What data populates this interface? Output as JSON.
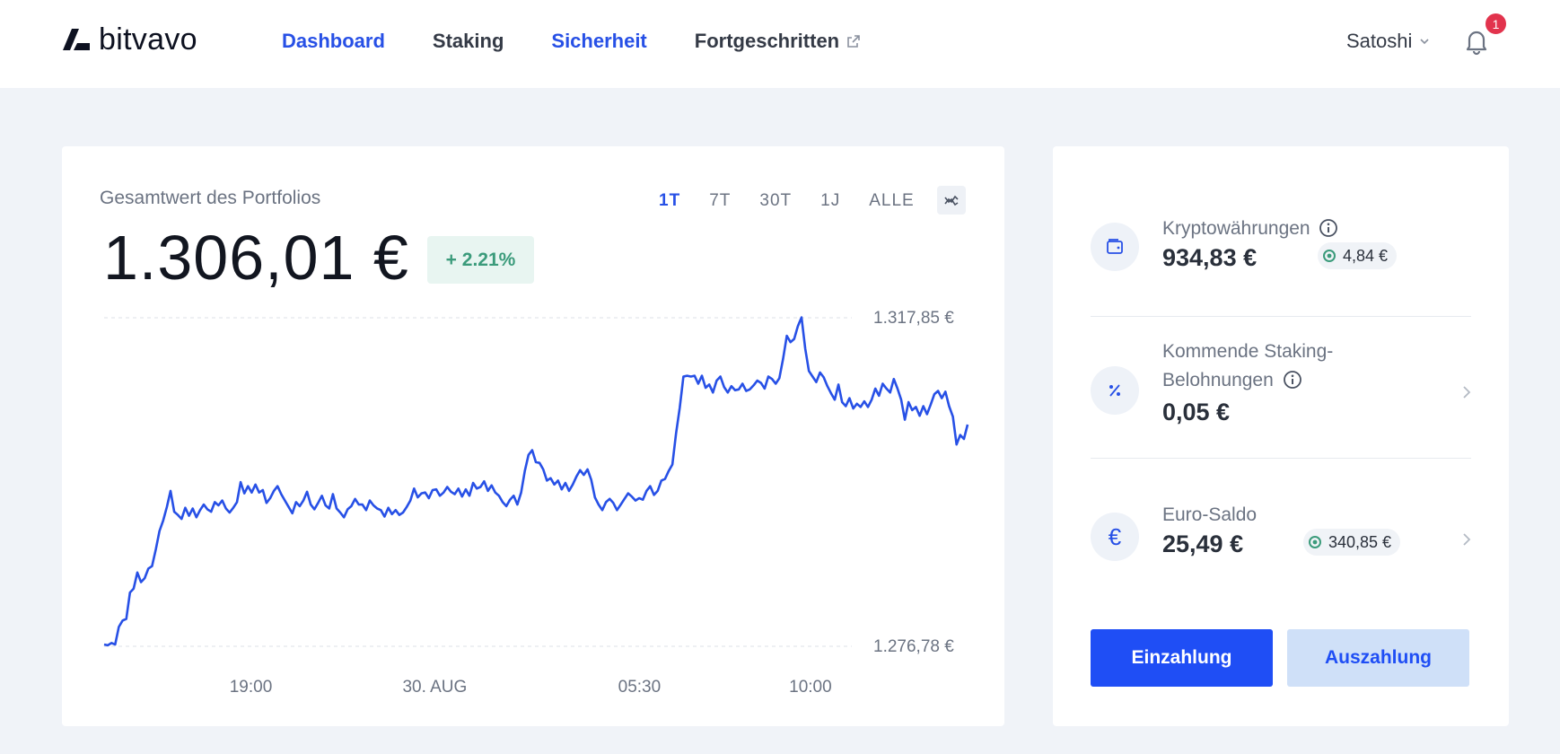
{
  "header": {
    "logo_text": "bitvavo",
    "nav": [
      {
        "label": "Dashboard",
        "active": true
      },
      {
        "label": "Staking",
        "active": false
      },
      {
        "label": "Sicherheit",
        "active": true
      },
      {
        "label": "Fortgeschritten",
        "active": false,
        "external": true
      }
    ],
    "user_name": "Satoshi",
    "notification_count": "1"
  },
  "portfolio": {
    "label": "Gesamtwert des Portfolios",
    "value": "1.306,01 €",
    "change": "+ 2.21%",
    "ranges": [
      "1T",
      "7T",
      "30T",
      "1J",
      "ALLE"
    ],
    "active_range": "1T"
  },
  "chart_data": {
    "type": "line",
    "ylim": [
      1276.78,
      1317.85
    ],
    "y_max_label": "1.317,85 €",
    "y_min_label": "1.276,78 €",
    "x_ticks": [
      {
        "label": "19:00",
        "t": 0.17
      },
      {
        "label": "30. AUG",
        "t": 0.383
      },
      {
        "label": "05:30",
        "t": 0.62
      },
      {
        "label": "10:00",
        "t": 0.818
      }
    ],
    "color": "#2750e6",
    "values": [
      1277.0,
      1276.9,
      1277.2,
      1277.0,
      1279.2,
      1280.0,
      1280.2,
      1283.5,
      1284.0,
      1286.0,
      1284.8,
      1285.3,
      1286.5,
      1286.8,
      1288.9,
      1291.2,
      1292.5,
      1294.2,
      1296.2,
      1293.6,
      1293.2,
      1292.7,
      1294.1,
      1293.1,
      1294.0,
      1292.9,
      1293.8,
      1294.5,
      1293.9,
      1293.6,
      1294.8,
      1294.4,
      1295.0,
      1294.0,
      1293.5,
      1294.1,
      1294.8,
      1297.3,
      1295.9,
      1296.8,
      1296.0,
      1297.0,
      1296.0,
      1296.3,
      1294.7,
      1295.3,
      1296.2,
      1296.8,
      1295.8,
      1295.0,
      1294.2,
      1293.4,
      1294.8,
      1294.3,
      1295.0,
      1296.1,
      1294.5,
      1293.9,
      1294.7,
      1295.6,
      1294.4,
      1294.0,
      1295.8,
      1294.0,
      1293.5,
      1292.9,
      1293.9,
      1294.3,
      1295.2,
      1294.5,
      1294.5,
      1293.8,
      1295.0,
      1294.4,
      1294.0,
      1293.8,
      1293.0,
      1294.1,
      1293.3,
      1293.8,
      1293.2,
      1293.5,
      1294.2,
      1295.0,
      1296.5,
      1295.4,
      1295.9,
      1296.0,
      1295.3,
      1296.3,
      1296.4,
      1295.6,
      1296.0,
      1296.7,
      1296.1,
      1295.8,
      1296.5,
      1295.5,
      1296.4,
      1295.6,
      1297.2,
      1296.5,
      1296.7,
      1297.4,
      1296.2,
      1296.9,
      1296.0,
      1295.6,
      1294.8,
      1294.3,
      1295.1,
      1295.6,
      1294.5,
      1296.0,
      1298.7,
      1300.7,
      1301.3,
      1299.8,
      1299.7,
      1298.9,
      1297.5,
      1297.8,
      1297.0,
      1297.5,
      1296.4,
      1297.2,
      1296.2,
      1297.0,
      1298.0,
      1298.8,
      1298.2,
      1298.9,
      1297.6,
      1295.4,
      1294.5,
      1293.8,
      1294.8,
      1295.2,
      1294.7,
      1293.8,
      1294.5,
      1295.2,
      1295.9,
      1295.5,
      1295.0,
      1295.3,
      1295.1,
      1296.2,
      1296.8,
      1295.7,
      1296.2,
      1297.5,
      1297.7,
      1298.7,
      1299.5,
      1303.4,
      1306.6,
      1310.5,
      1310.6,
      1310.5,
      1310.6,
      1309.6,
      1310.6,
      1309.1,
      1309.5,
      1308.5,
      1310.0,
      1310.5,
      1309.2,
      1308.5,
      1309.3,
      1308.8,
      1308.9,
      1309.6,
      1308.7,
      1308.9,
      1309.4,
      1310.0,
      1309.7,
      1309.0,
      1310.5,
      1310.2,
      1309.6,
      1310.3,
      1312.7,
      1315.6,
      1314.8,
      1315.2,
      1316.8,
      1317.9,
      1314.0,
      1311.2,
      1310.5,
      1309.8,
      1311.0,
      1310.4,
      1309.3,
      1308.4,
      1307.6,
      1309.5,
      1307.3,
      1306.8,
      1307.8,
      1306.5,
      1307.1,
      1306.7,
      1307.4,
      1306.7,
      1307.6,
      1309.0,
      1308.1,
      1309.6,
      1309.0,
      1308.5,
      1310.2,
      1309.0,
      1307.6,
      1305.1,
      1307.3,
      1306.3,
      1306.7,
      1305.6,
      1306.8,
      1305.8,
      1307.0,
      1308.3,
      1308.7,
      1307.8,
      1308.6,
      1306.8,
      1305.5,
      1302.0,
      1303.2,
      1302.7,
      1304.5
    ]
  },
  "side": {
    "crypto": {
      "label": "Kryptowährungen",
      "value": "934,83 €",
      "staking": "4,84 €"
    },
    "staking_rewards": {
      "label_line1": "Kommende Staking-",
      "label_line2": "Belohnungen",
      "value": "0,05 €"
    },
    "euro": {
      "label": "Euro-Saldo",
      "value": "25,49 €",
      "staking": "340,85 €",
      "symbol": "€"
    },
    "deposit_label": "Einzahlung",
    "withdraw_label": "Auszahlung"
  }
}
